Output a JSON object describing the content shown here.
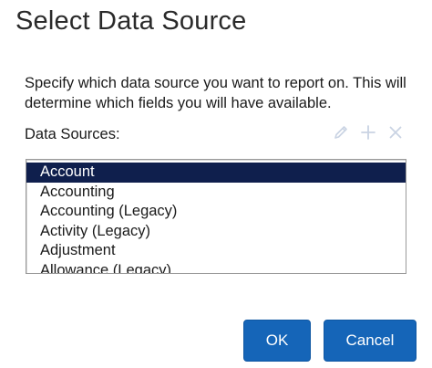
{
  "dialog": {
    "title": "Select Data Source",
    "description": "Specify which data source you want to report on. This will determine which fields you will have available.",
    "sources_label": "Data Sources:"
  },
  "toolbar": {
    "edit_icon": "pencil-icon",
    "add_icon": "plus-icon",
    "remove_icon": "close-icon",
    "icon_color": "#c9d3e3"
  },
  "data_sources": {
    "selected_index": 0,
    "items": [
      "Account",
      "Accounting",
      "Accounting (Legacy)",
      "Activity (Legacy)",
      "Adjustment",
      "Allowance (Legacy)"
    ]
  },
  "buttons": {
    "ok_label": "OK",
    "cancel_label": "Cancel"
  },
  "colors": {
    "selection": "#0f1f4d",
    "button": "#1565b8"
  }
}
